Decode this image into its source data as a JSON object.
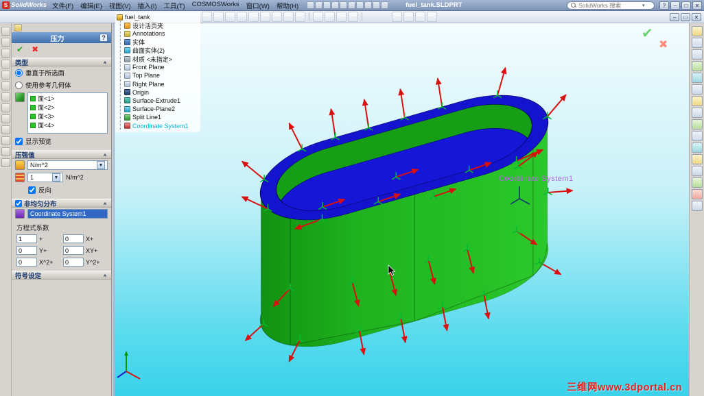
{
  "titlebar": {
    "app_name": "SolidWorks",
    "menus": [
      "文件(F)",
      "编辑(E)",
      "视图(V)",
      "插入(I)",
      "工具(T)",
      "COSMOSWorks",
      "窗口(W)",
      "帮助(H)"
    ],
    "document_title": "fuel_tank.SLDPRT",
    "search_placeholder": "SolidWorks 搜索",
    "buttons": {
      "help": "?",
      "minimize": "–",
      "maximize": "□",
      "close": "✕"
    }
  },
  "doc_window_buttons": {
    "minimize": "–",
    "restore": "□",
    "close": "✕"
  },
  "property_manager": {
    "title": "压力",
    "help_button": "?",
    "confirm": "✔",
    "cancel": "✖",
    "type_section": {
      "header": "类型",
      "option_normal": "垂直于所选面",
      "option_reference": "使用参考几何体",
      "faces": [
        "面<1>",
        "面<2>",
        "面<3>",
        "面<4>"
      ],
      "show_preview": "显示预览"
    },
    "pressure_section": {
      "header": "压强值",
      "unit_system": "N/m^2",
      "value": "1",
      "unit": "N/m^2",
      "reverse": "反向"
    },
    "nonuniform_section": {
      "header": "非均匀分布",
      "coordinate_system": "Coordinate System1",
      "coefficients_label": "方程式系数",
      "rows": [
        {
          "v1": "1",
          "l1": "+",
          "v2": "0",
          "l2": "X+"
        },
        {
          "v1": "0",
          "l1": "Y+",
          "v2": "0",
          "l2": "XY+"
        },
        {
          "v1": "0",
          "l1": "X^2+",
          "v2": "0",
          "l2": "Y^2+"
        }
      ]
    },
    "symbol_section": {
      "header": "符号设定"
    }
  },
  "feature_tree": [
    "fuel_tank",
    "设计活页夹",
    "Annotations",
    "实体",
    "曲面实体(2)",
    "材质 <未指定>",
    "Front Plane",
    "Top Plane",
    "Right Plane",
    "Origin",
    "Surface-Extrude1",
    "Surface-Plane2",
    "Split Line1",
    "Coordinate System1"
  ],
  "viewport": {
    "coordinate_label": "Coordinate System1",
    "watermark": "三维网www.3dportal.cn"
  },
  "colors": {
    "tank_green": "#1fb31f",
    "tank_blue": "#1414cf",
    "arrow_red": "#d81010",
    "symbol_green": "#00bb33",
    "highlight_cyan": "#00b8e0",
    "annotation_purple": "#b36ae2",
    "watermark_red": "#e82020"
  }
}
